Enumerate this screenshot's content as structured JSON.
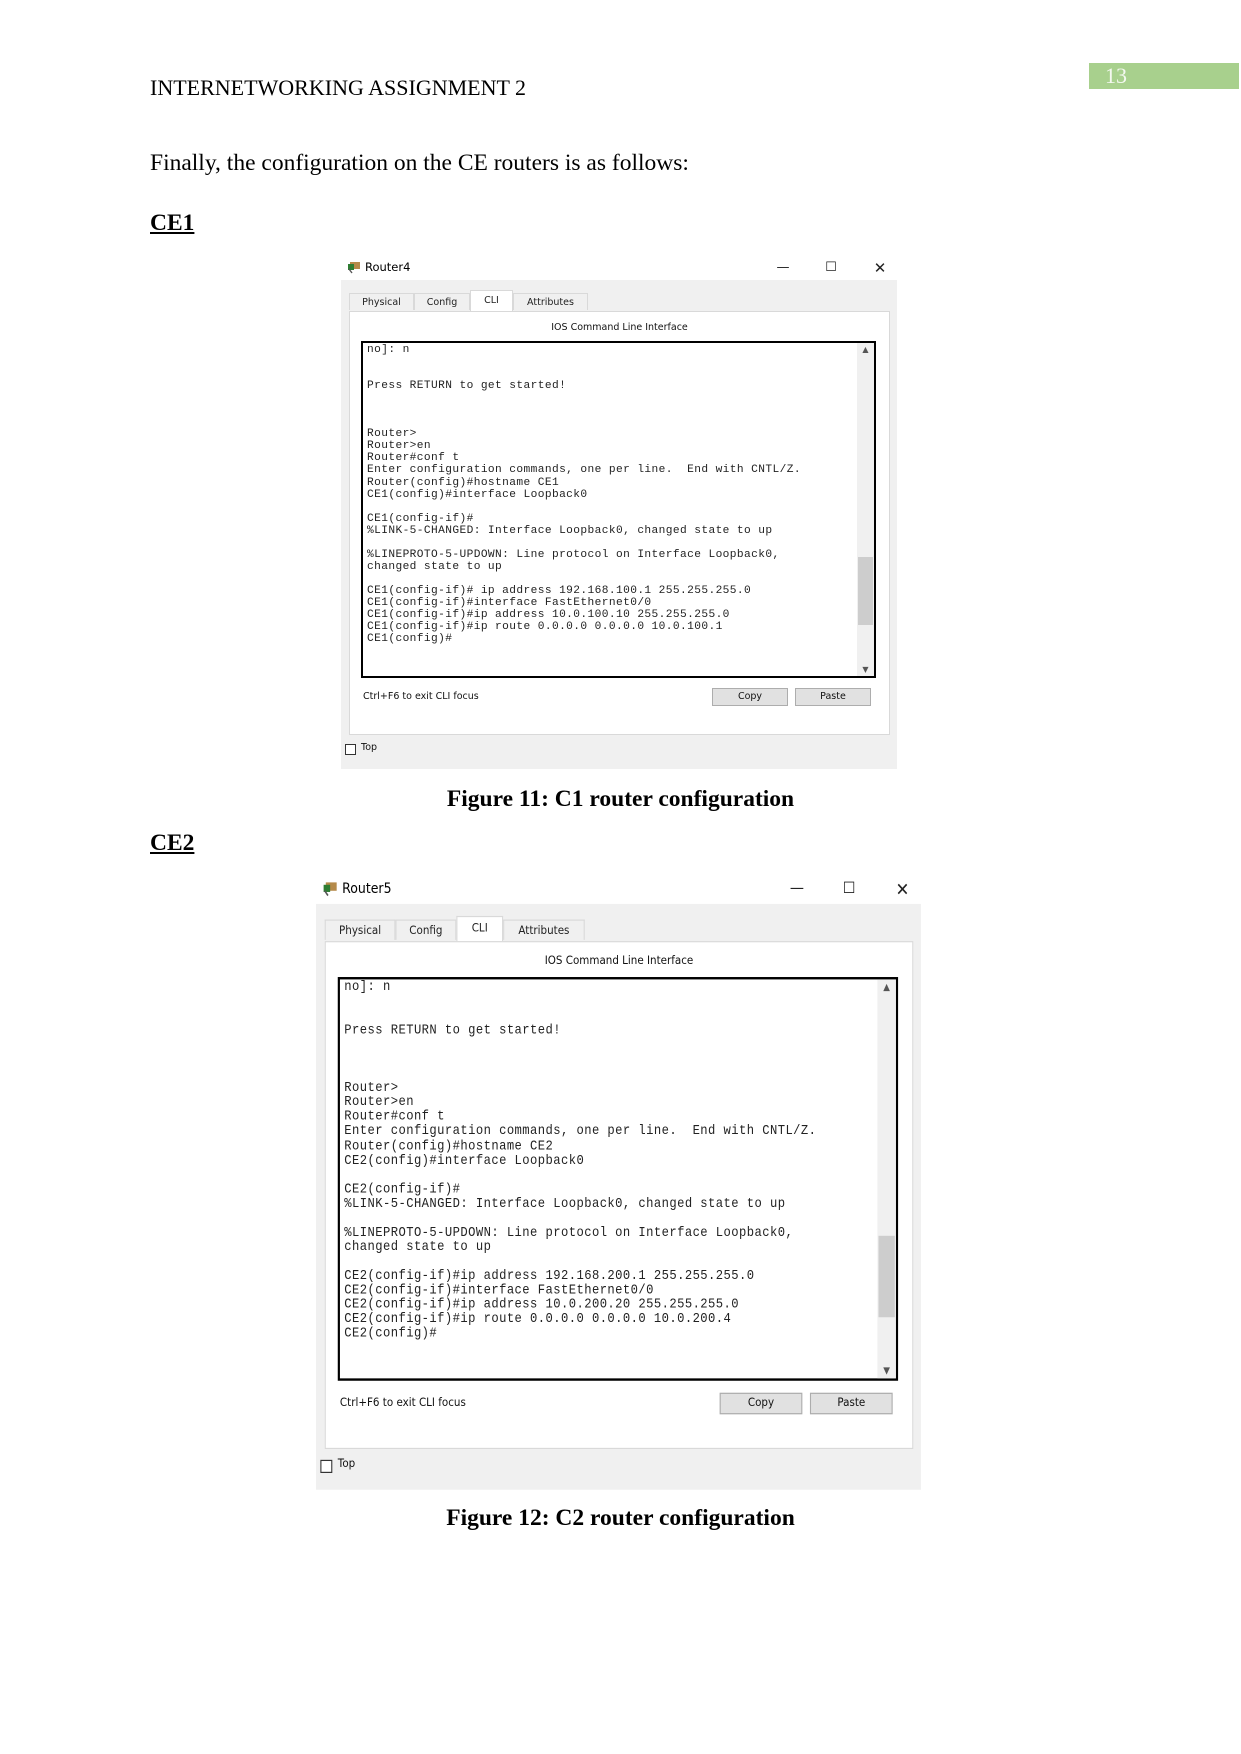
{
  "header": {
    "title": "INTERNETWORKING ASSIGNMENT 2",
    "page_number": "13",
    "page_number_bg": "#a8d08d"
  },
  "intro": "Finally, the configuration on the CE routers is as follows:",
  "sections": [
    {
      "heading": "CE1",
      "caption": "Figure 11: C1 router configuration",
      "window": {
        "title": "Router4",
        "tabs": [
          "Physical",
          "Config",
          "CLI",
          "Attributes"
        ],
        "active_tab": "CLI",
        "panel_heading": "IOS Command Line Interface",
        "terminal_lines": [
          "no]: n",
          "",
          "",
          "Press RETURN to get started!",
          "",
          "",
          "",
          "Router>",
          "Router>en",
          "Router#conf t",
          "Enter configuration commands, one per line.  End with CNTL/Z.",
          "Router(config)#hostname CE1",
          "CE1(config)#interface Loopback0",
          "",
          "CE1(config-if)#",
          "%LINK-5-CHANGED: Interface Loopback0, changed state to up",
          "",
          "%LINEPROTO-5-UPDOWN: Line protocol on Interface Loopback0,",
          "changed state to up",
          "",
          "CE1(config-if)# ip address 192.168.100.1 255.255.255.0",
          "CE1(config-if)#interface FastEthernet0/0",
          "CE1(config-if)#ip address 10.0.100.10 255.255.255.0",
          "CE1(config-if)#ip route 0.0.0.0 0.0.0.0 10.0.100.1",
          "CE1(config)#"
        ],
        "footer_hint": "Ctrl+F6 to exit CLI focus",
        "copy_label": "Copy",
        "paste_label": "Paste",
        "top_label": "Top",
        "top_checked": false
      }
    },
    {
      "heading": "CE2",
      "caption": "Figure 12: C2 router configuration",
      "window": {
        "title": "Router5",
        "tabs": [
          "Physical",
          "Config",
          "CLI",
          "Attributes"
        ],
        "active_tab": "CLI",
        "panel_heading": "IOS Command Line Interface",
        "terminal_lines": [
          "no]: n",
          "",
          "",
          "Press RETURN to get started!",
          "",
          "",
          "",
          "Router>",
          "Router>en",
          "Router#conf t",
          "Enter configuration commands, one per line.  End with CNTL/Z.",
          "Router(config)#hostname CE2",
          "CE2(config)#interface Loopback0",
          "",
          "CE2(config-if)#",
          "%LINK-5-CHANGED: Interface Loopback0, changed state to up",
          "",
          "%LINEPROTO-5-UPDOWN: Line protocol on Interface Loopback0,",
          "changed state to up",
          "",
          "CE2(config-if)#ip address 192.168.200.1 255.255.255.0",
          "CE2(config-if)#interface FastEthernet0/0",
          "CE2(config-if)#ip address 10.0.200.20 255.255.255.0",
          "CE2(config-if)#ip route 0.0.0.0 0.0.0.0 10.0.200.4",
          "CE2(config)#"
        ],
        "footer_hint": "Ctrl+F6 to exit CLI focus",
        "copy_label": "Copy",
        "paste_label": "Paste",
        "top_label": "Top",
        "top_checked": false
      }
    }
  ]
}
